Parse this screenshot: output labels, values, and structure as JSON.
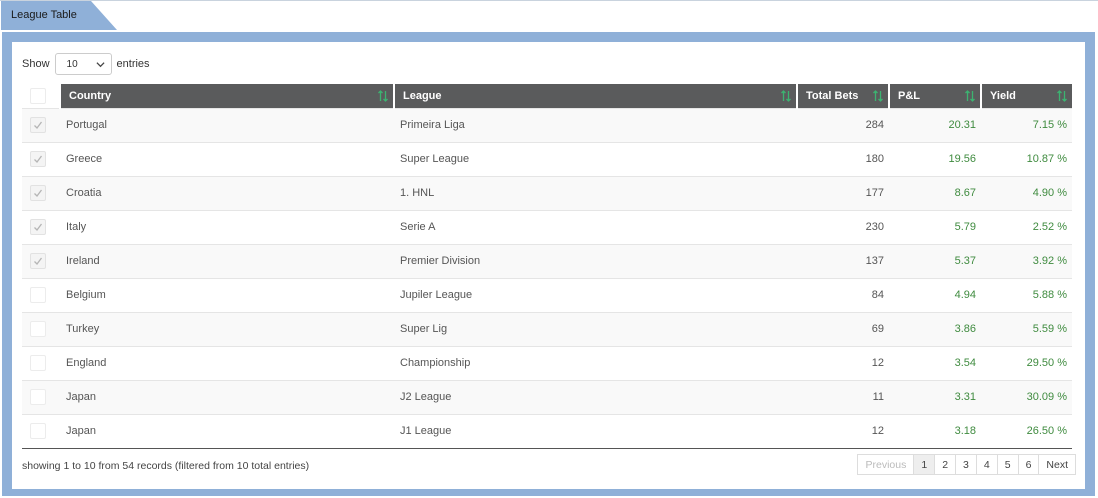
{
  "tab": {
    "label": "League Table"
  },
  "length_menu": {
    "show": "Show",
    "value": "10",
    "entries": "entries"
  },
  "columns": [
    "Country",
    "League",
    "Total Bets",
    "P&L",
    "Yield"
  ],
  "rows": [
    {
      "checked": true,
      "country": "Portugal",
      "league": "Primeira Liga",
      "bets": "284",
      "pl": "20.31",
      "yield": "7.15 %"
    },
    {
      "checked": true,
      "country": "Greece",
      "league": "Super League",
      "bets": "180",
      "pl": "19.56",
      "yield": "10.87 %"
    },
    {
      "checked": true,
      "country": "Croatia",
      "league": "1. HNL",
      "bets": "177",
      "pl": "8.67",
      "yield": "4.90 %"
    },
    {
      "checked": true,
      "country": "Italy",
      "league": "Serie A",
      "bets": "230",
      "pl": "5.79",
      "yield": "2.52 %"
    },
    {
      "checked": true,
      "country": "Ireland",
      "league": "Premier Division",
      "bets": "137",
      "pl": "5.37",
      "yield": "3.92 %"
    },
    {
      "checked": false,
      "country": "Belgium",
      "league": "Jupiler League",
      "bets": "84",
      "pl": "4.94",
      "yield": "5.88 %"
    },
    {
      "checked": false,
      "country": "Turkey",
      "league": "Super Lig",
      "bets": "69",
      "pl": "3.86",
      "yield": "5.59 %"
    },
    {
      "checked": false,
      "country": "England",
      "league": "Championship",
      "bets": "12",
      "pl": "3.54",
      "yield": "29.50 %"
    },
    {
      "checked": false,
      "country": "Japan",
      "league": "J2 League",
      "bets": "11",
      "pl": "3.31",
      "yield": "30.09 %"
    },
    {
      "checked": false,
      "country": "Japan",
      "league": "J1 League",
      "bets": "12",
      "pl": "3.18",
      "yield": "26.50 %"
    }
  ],
  "footer": {
    "info": "showing 1 to 10 from 54 records (filtered from 10 total entries)"
  },
  "pagination": {
    "previous": "Previous",
    "pages": [
      "1",
      "2",
      "3",
      "4",
      "5",
      "6"
    ],
    "active": "1",
    "next": "Next"
  },
  "colors": {
    "frame": "#8fb0d8",
    "tab": "#8fb0d8",
    "header": "#5a5b5c",
    "sort_icon": "#3cb371",
    "positive": "#3f8b3f"
  }
}
